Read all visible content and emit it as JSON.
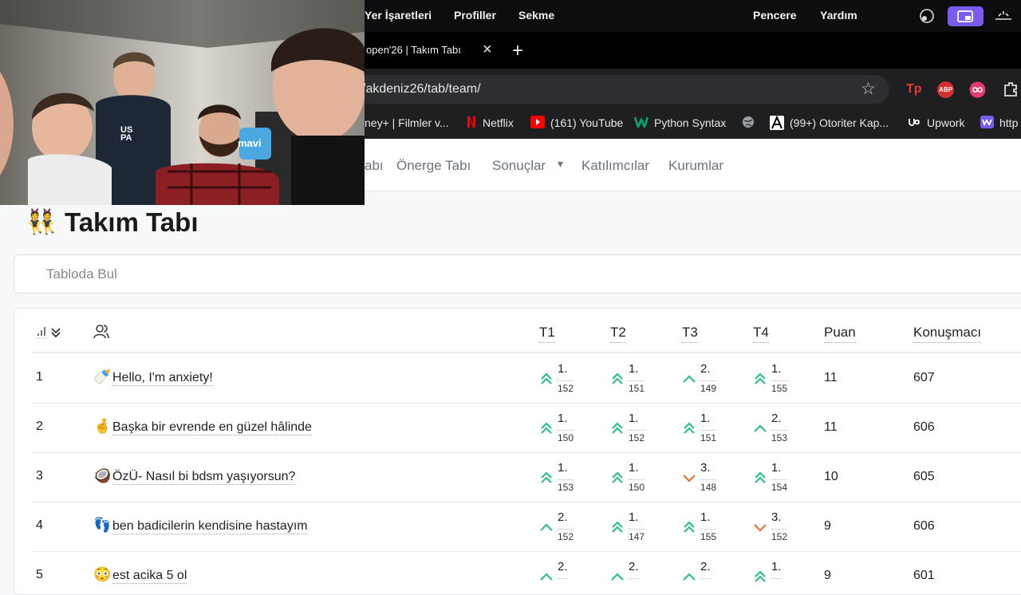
{
  "menubar": {
    "items": [
      "Yer İşaretleri",
      "Profiller",
      "Sekme",
      "Pencere",
      "Yardım"
    ]
  },
  "browser": {
    "tab_title": "open'26 | Takım Tabı",
    "close_glyph": "×",
    "new_tab_glyph": "+",
    "url": "/akdeniz26/tab/team/",
    "star_glyph": "☆",
    "bookmarks": [
      "ney+ | Filmler v...",
      "Netflix",
      "(161) YouTube",
      "Python Syntax",
      "(99+) Otoriter Kap...",
      "Upwork",
      "http"
    ],
    "ext_labels": [
      "Tp",
      "ABP"
    ]
  },
  "nav": {
    "items": [
      "abı",
      "Önerge Tabı",
      "Sonuçlar",
      "Katılımcılar",
      "Kurumlar"
    ],
    "dropdown_glyph": "▾"
  },
  "page": {
    "title_emoji": "👯",
    "title": "Takım Tabı",
    "search_placeholder": "Tabloda Bul"
  },
  "table": {
    "headers": [
      "T1",
      "T2",
      "T3",
      "T4",
      "Puan",
      "Konuşmacı"
    ],
    "rows": [
      {
        "rank": "1",
        "emoji": "🍼",
        "name": "Hello, I'm anxiety!",
        "rounds": [
          {
            "p": "1.",
            "s": "152",
            "d": "dbl"
          },
          {
            "p": "1.",
            "s": "151",
            "d": "dbl"
          },
          {
            "p": "2.",
            "s": "149",
            "d": "up"
          },
          {
            "p": "1.",
            "s": "155",
            "d": "dbl"
          }
        ],
        "points": "11",
        "speaker": "607"
      },
      {
        "rank": "2",
        "emoji": "🤞",
        "name": "Başka bir evrende en güzel hâlinde",
        "rounds": [
          {
            "p": "1.",
            "s": "150",
            "d": "dbl"
          },
          {
            "p": "1.",
            "s": "152",
            "d": "dbl"
          },
          {
            "p": "1.",
            "s": "151",
            "d": "dbl"
          },
          {
            "p": "2.",
            "s": "153",
            "d": "up"
          }
        ],
        "points": "11",
        "speaker": "606"
      },
      {
        "rank": "3",
        "emoji": "🥥",
        "name": "ÖzÜ- Nasıl bi bdsm yaşıyorsun?",
        "rounds": [
          {
            "p": "1.",
            "s": "153",
            "d": "dbl"
          },
          {
            "p": "1.",
            "s": "150",
            "d": "dbl"
          },
          {
            "p": "3.",
            "s": "148",
            "d": "down"
          },
          {
            "p": "1.",
            "s": "154",
            "d": "dbl"
          }
        ],
        "points": "10",
        "speaker": "605"
      },
      {
        "rank": "4",
        "emoji": "👣",
        "name": "ben badicilerin kendisine hastayım",
        "rounds": [
          {
            "p": "2.",
            "s": "152",
            "d": "up"
          },
          {
            "p": "1.",
            "s": "147",
            "d": "dbl"
          },
          {
            "p": "1.",
            "s": "155",
            "d": "dbl"
          },
          {
            "p": "3.",
            "s": "152",
            "d": "down"
          }
        ],
        "points": "9",
        "speaker": "606"
      },
      {
        "rank": "5",
        "emoji": "😳",
        "name": "est acika 5 ol",
        "rounds": [
          {
            "p": "2.",
            "s": "",
            "d": "up"
          },
          {
            "p": "2.",
            "s": "",
            "d": "up"
          },
          {
            "p": "2.",
            "s": "",
            "d": "up"
          },
          {
            "p": "1.",
            "s": "",
            "d": "dbl"
          }
        ],
        "points": "9",
        "speaker": "601"
      }
    ]
  },
  "colors": {
    "up": "#2bbf8f",
    "down": "#e8713a"
  },
  "webcam": {
    "shirt_text": "US PA",
    "bag_text": "mavi"
  }
}
